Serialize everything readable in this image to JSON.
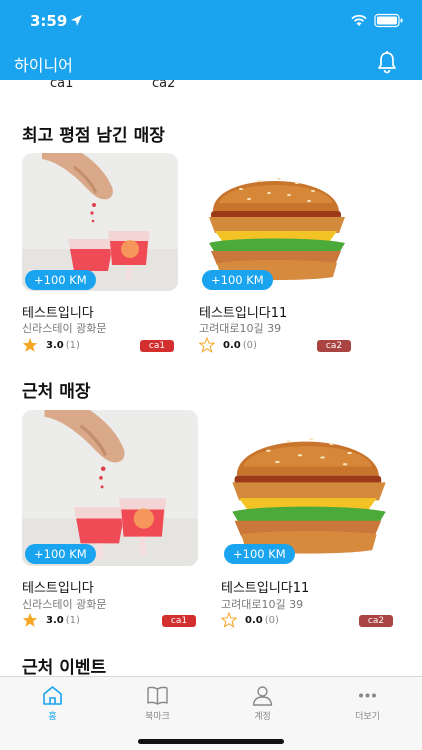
{
  "status": {
    "time": "3:59"
  },
  "header": {
    "title": "하이니어"
  },
  "categories_row": [
    "ca1",
    "ca2"
  ],
  "sections": {
    "top_rated": {
      "title": "최고 평점 남긴 매장"
    },
    "nearby": {
      "title": "근처 매장"
    },
    "events": {
      "title": "근처 이벤트"
    }
  },
  "stores": {
    "top_rated": [
      {
        "distance": "+100 KM",
        "name": "테스트입니다",
        "address": "신라스테이 광화문",
        "rating": "3.0",
        "count": "(1)",
        "category": "ca1",
        "category_color": "#d32f2f",
        "image": "cocktail-photo"
      },
      {
        "distance": "+100 KM",
        "name": "테스트입니다11",
        "address": "고려대로10길 39",
        "rating": "0.0",
        "count": "(0)",
        "category": "ca2",
        "category_color": "#a94442",
        "image": "burger-photo"
      }
    ],
    "nearby": [
      {
        "distance": "+100 KM",
        "name": "테스트입니다",
        "address": "신라스테이 광화문",
        "rating": "3.0",
        "count": "(1)",
        "category": "ca1",
        "category_color": "#d32f2f",
        "image": "cocktail-photo"
      },
      {
        "distance": "+100 KM",
        "name": "테스트입니다11",
        "address": "고려대로10길 39",
        "rating": "0.0",
        "count": "(0)",
        "category": "ca2",
        "category_color": "#a94442",
        "image": "burger-photo"
      }
    ]
  },
  "tabs": [
    {
      "label": "홈",
      "icon": "home-icon",
      "active": true
    },
    {
      "label": "북마크",
      "icon": "book-icon",
      "active": false
    },
    {
      "label": "계정",
      "icon": "person-icon",
      "active": false
    },
    {
      "label": "더보기",
      "icon": "more-icon",
      "active": false
    }
  ],
  "colors": {
    "accent": "#1aa3ef",
    "star": "#f5a623"
  }
}
